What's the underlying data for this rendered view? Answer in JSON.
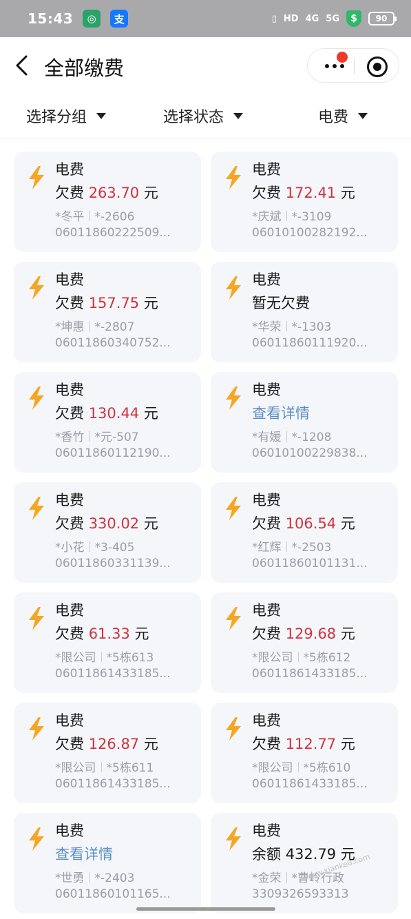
{
  "status_bar": {
    "time": "15:43",
    "apps": [
      {
        "icon": "globe-app-icon",
        "glyph": "◎",
        "color": "#2aa36b"
      },
      {
        "icon": "alipay-icon",
        "glyph": "支",
        "color": "#1677ff"
      }
    ],
    "hd": "HD",
    "signal1": "4G",
    "signal2": "5G",
    "shield_glyph": "$",
    "battery": "90"
  },
  "header": {
    "title": "全部缴费"
  },
  "filters": [
    {
      "label": "选择分组"
    },
    {
      "label": "选择状态"
    },
    {
      "label": "电费"
    }
  ],
  "cards": [
    {
      "type": "电费",
      "kind": "due",
      "prefix": "欠费",
      "amount": "263.70",
      "unit": "元",
      "name": "*冬平",
      "addr": "*-2606",
      "account": "06011860222509..."
    },
    {
      "type": "电费",
      "kind": "due",
      "prefix": "欠费",
      "amount": "172.41",
      "unit": "元",
      "name": "*庆斌",
      "addr": "*-3109",
      "account": "06010100282192..."
    },
    {
      "type": "电费",
      "kind": "due",
      "prefix": "欠费",
      "amount": "157.75",
      "unit": "元",
      "name": "*坤惠",
      "addr": "*-2807",
      "account": "06011860340752..."
    },
    {
      "type": "电费",
      "kind": "plain",
      "text": "暂无欠费",
      "name": "*华荣",
      "addr": "*-1303",
      "account": "06011860111920..."
    },
    {
      "type": "电费",
      "kind": "due",
      "prefix": "欠费",
      "amount": "130.44",
      "unit": "元",
      "name": "*香竹",
      "addr": "*元-507",
      "account": "06011860112190..."
    },
    {
      "type": "电费",
      "kind": "link",
      "text": "查看详情",
      "name": "*有媛",
      "addr": "*-1208",
      "account": "06010100229838..."
    },
    {
      "type": "电费",
      "kind": "due",
      "prefix": "欠费",
      "amount": "330.02",
      "unit": "元",
      "name": "*小花",
      "addr": "*3-405",
      "account": "06011860331139..."
    },
    {
      "type": "电费",
      "kind": "due",
      "prefix": "欠费",
      "amount": "106.54",
      "unit": "元",
      "name": "*红辉",
      "addr": "*-2503",
      "account": "06011860101131..."
    },
    {
      "type": "电费",
      "kind": "due",
      "prefix": "欠费",
      "amount": "61.33",
      "unit": "元",
      "name": "*限公司",
      "addr": "*5栋613",
      "account": "06011861433185..."
    },
    {
      "type": "电费",
      "kind": "due",
      "prefix": "欠费",
      "amount": "129.68",
      "unit": "元",
      "name": "*限公司",
      "addr": "*5栋612",
      "account": "06011861433185..."
    },
    {
      "type": "电费",
      "kind": "due",
      "prefix": "欠费",
      "amount": "126.87",
      "unit": "元",
      "name": "*限公司",
      "addr": "*5栋611",
      "account": "06011861433185..."
    },
    {
      "type": "电费",
      "kind": "due",
      "prefix": "欠费",
      "amount": "112.77",
      "unit": "元",
      "name": "*限公司",
      "addr": "*5栋610",
      "account": "06011861433185..."
    },
    {
      "type": "电费",
      "kind": "link",
      "text": "查看详情",
      "name": "*世勇",
      "addr": "*-2403",
      "account": "06011860101165..."
    },
    {
      "type": "电费",
      "kind": "balance",
      "prefix": "余额",
      "amount": "432.79",
      "unit": "元",
      "name": "*金荣",
      "addr": "*曹岭行政",
      "account": "3309326593313"
    }
  ],
  "colors": {
    "amount_red": "#d2323c",
    "link_blue": "#5a8fc4",
    "bolt_orange": "#f5a623",
    "card_bg": "#f5f6fa"
  }
}
